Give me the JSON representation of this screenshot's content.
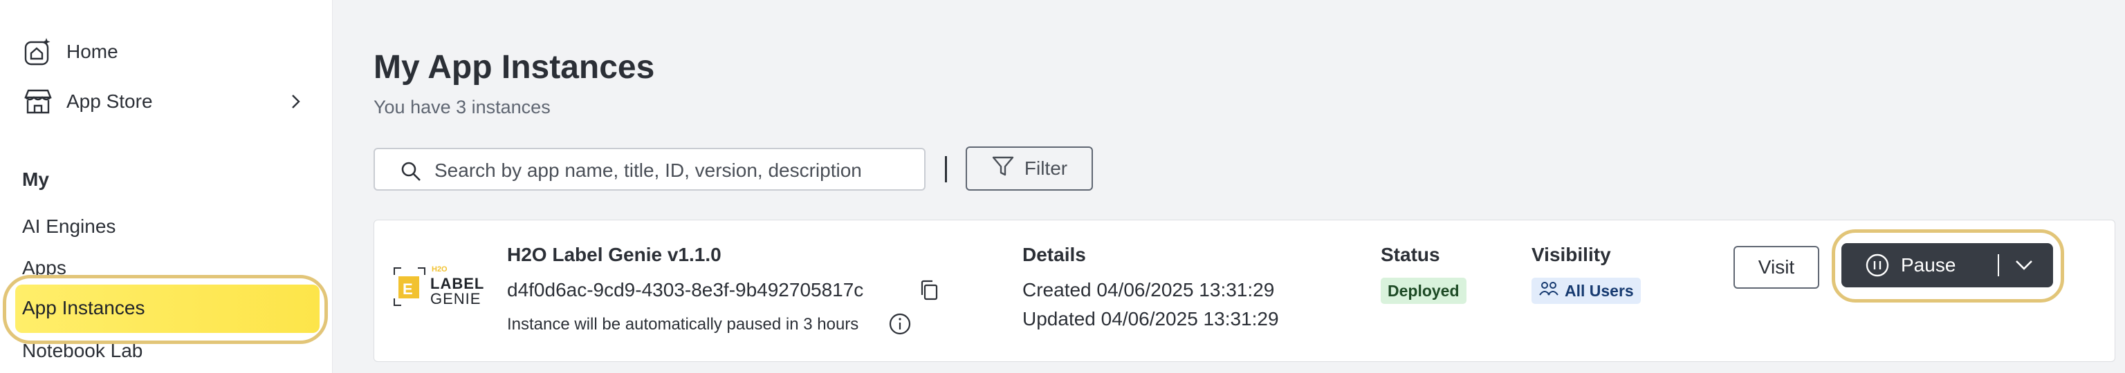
{
  "sidebar": {
    "home_label": "Home",
    "app_store_label": "App Store",
    "section_my": "My",
    "items": [
      "AI Engines",
      "Apps",
      "App Instances",
      "Notebook Lab"
    ]
  },
  "main": {
    "title": "My App Instances",
    "subtitle": "You have 3 instances",
    "search_placeholder": "Search by app name, title, ID, version, description",
    "filter_label": "Filter"
  },
  "instance": {
    "logo_text_top": "H2O",
    "logo_text_label": "LABEL",
    "logo_text_genie": "GENIE",
    "name": "H2O Label Genie v1.1.0",
    "id": "d4f0d6ac-9cd9-4303-8e3f-9b492705817c",
    "pause_note": "Instance will be automatically paused in 3 hours",
    "details_header": "Details",
    "created": "Created 04/06/2025 13:31:29",
    "updated": "Updated 04/06/2025 13:31:29",
    "status_header": "Status",
    "status": "Deployed",
    "visibility_header": "Visibility",
    "visibility": "All Users",
    "visit_label": "Visit",
    "pause_label": "Pause"
  },
  "colors": {
    "active_highlight": "#fde54a",
    "highlight_ring": "#e2c578",
    "pause_button": "#373c44",
    "deployed_badge": "#d9f2dc",
    "visibility_badge": "#e2ecfb"
  }
}
